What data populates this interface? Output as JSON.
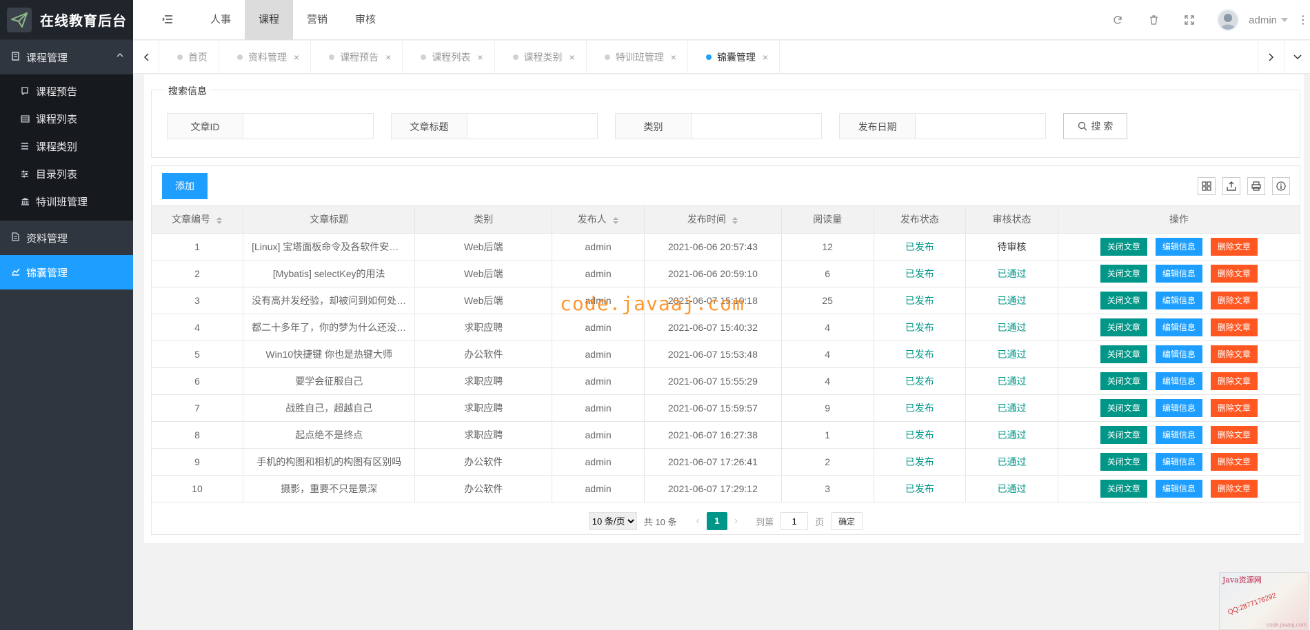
{
  "app": {
    "title": "在线教育后台"
  },
  "sidebar": {
    "group_course": "课程管理",
    "course_items": [
      {
        "label": "课程预告",
        "icon": "bookmark-icon"
      },
      {
        "label": "课程列表",
        "icon": "list-icon"
      },
      {
        "label": "课程类别",
        "icon": "menu-icon"
      },
      {
        "label": "目录列表",
        "icon": "sliders-icon"
      },
      {
        "label": "特训班管理",
        "icon": "bank-icon"
      }
    ],
    "group_material": "资料管理",
    "group_kit": "锦囊管理"
  },
  "header": {
    "nav": [
      "人事",
      "课程",
      "营销",
      "审核"
    ],
    "active_nav": "课程",
    "user": "admin"
  },
  "tabs": [
    {
      "label": "首页",
      "closable": false,
      "active": false
    },
    {
      "label": "资料管理",
      "closable": true,
      "active": false
    },
    {
      "label": "课程预告",
      "closable": true,
      "active": false
    },
    {
      "label": "课程列表",
      "closable": true,
      "active": false
    },
    {
      "label": "课程类别",
      "closable": true,
      "active": false
    },
    {
      "label": "特训班管理",
      "closable": true,
      "active": false
    },
    {
      "label": "锦囊管理",
      "closable": true,
      "active": true
    }
  ],
  "tab_close_glyph": "×",
  "search": {
    "legend": "搜索信息",
    "fields": [
      "文章ID",
      "文章标题",
      "类别",
      "发布日期"
    ],
    "button": "搜 索"
  },
  "toolbar": {
    "add": "添加"
  },
  "table": {
    "headers": [
      "文章编号",
      "文章标题",
      "类别",
      "发布人",
      "发布时间",
      "阅读量",
      "发布状态",
      "审核状态",
      "操作"
    ],
    "rows": [
      [
        "1",
        "[Linux] 宝塔面板命令及各软件安装路径",
        "Web后端",
        "admin",
        "2021-06-06 20:57:43",
        "12",
        "已发布",
        "待审核"
      ],
      [
        "2",
        "[Mybatis] selectKey的用法",
        "Web后端",
        "admin",
        "2021-06-06 20:59:10",
        "6",
        "已发布",
        "已通过"
      ],
      [
        "3",
        "没有高并发经验，却被问到如何处理高并发",
        "Web后端",
        "admin",
        "2021-06-07 15:10:18",
        "25",
        "已发布",
        "已通过"
      ],
      [
        "4",
        "都二十多年了，你的梦为什么还没有实现",
        "求职应聘",
        "admin",
        "2021-06-07 15:40:32",
        "4",
        "已发布",
        "已通过"
      ],
      [
        "5",
        "Win10快捷键 你也是热键大师",
        "办公软件",
        "admin",
        "2021-06-07 15:53:48",
        "4",
        "已发布",
        "已通过"
      ],
      [
        "6",
        "要学会征服自己",
        "求职应聘",
        "admin",
        "2021-06-07 15:55:29",
        "4",
        "已发布",
        "已通过"
      ],
      [
        "7",
        "战胜自己，超越自己",
        "求职应聘",
        "admin",
        "2021-06-07 15:59:57",
        "9",
        "已发布",
        "已通过"
      ],
      [
        "8",
        "起点绝不是终点",
        "求职应聘",
        "admin",
        "2021-06-07 16:27:38",
        "1",
        "已发布",
        "已通过"
      ],
      [
        "9",
        "手机的构图和相机的构图有区别吗",
        "办公软件",
        "admin",
        "2021-06-07 17:26:41",
        "2",
        "已发布",
        "已通过"
      ],
      [
        "10",
        "摄影，重要不只是景深",
        "办公软件",
        "admin",
        "2021-06-07 17:29:12",
        "3",
        "已发布",
        "已通过"
      ]
    ],
    "actions": [
      "关闭文章",
      "编辑信息",
      "删除文章"
    ]
  },
  "pager": {
    "page_size": "10 条/页",
    "total": "共 10 条",
    "current": "1",
    "goto_label": "到第",
    "goto_value": "1",
    "unit": "页",
    "confirm": "确定"
  },
  "watermark": "code.javaaj.com",
  "corner_ad": {
    "title": "Java资源网",
    "qq": "QQ:2877176292",
    "url": "code.javaaj.com"
  },
  "colors": {
    "primary": "#1e9fff",
    "success": "#009688",
    "danger": "#ff5722",
    "sidebar": "#2f3640"
  }
}
